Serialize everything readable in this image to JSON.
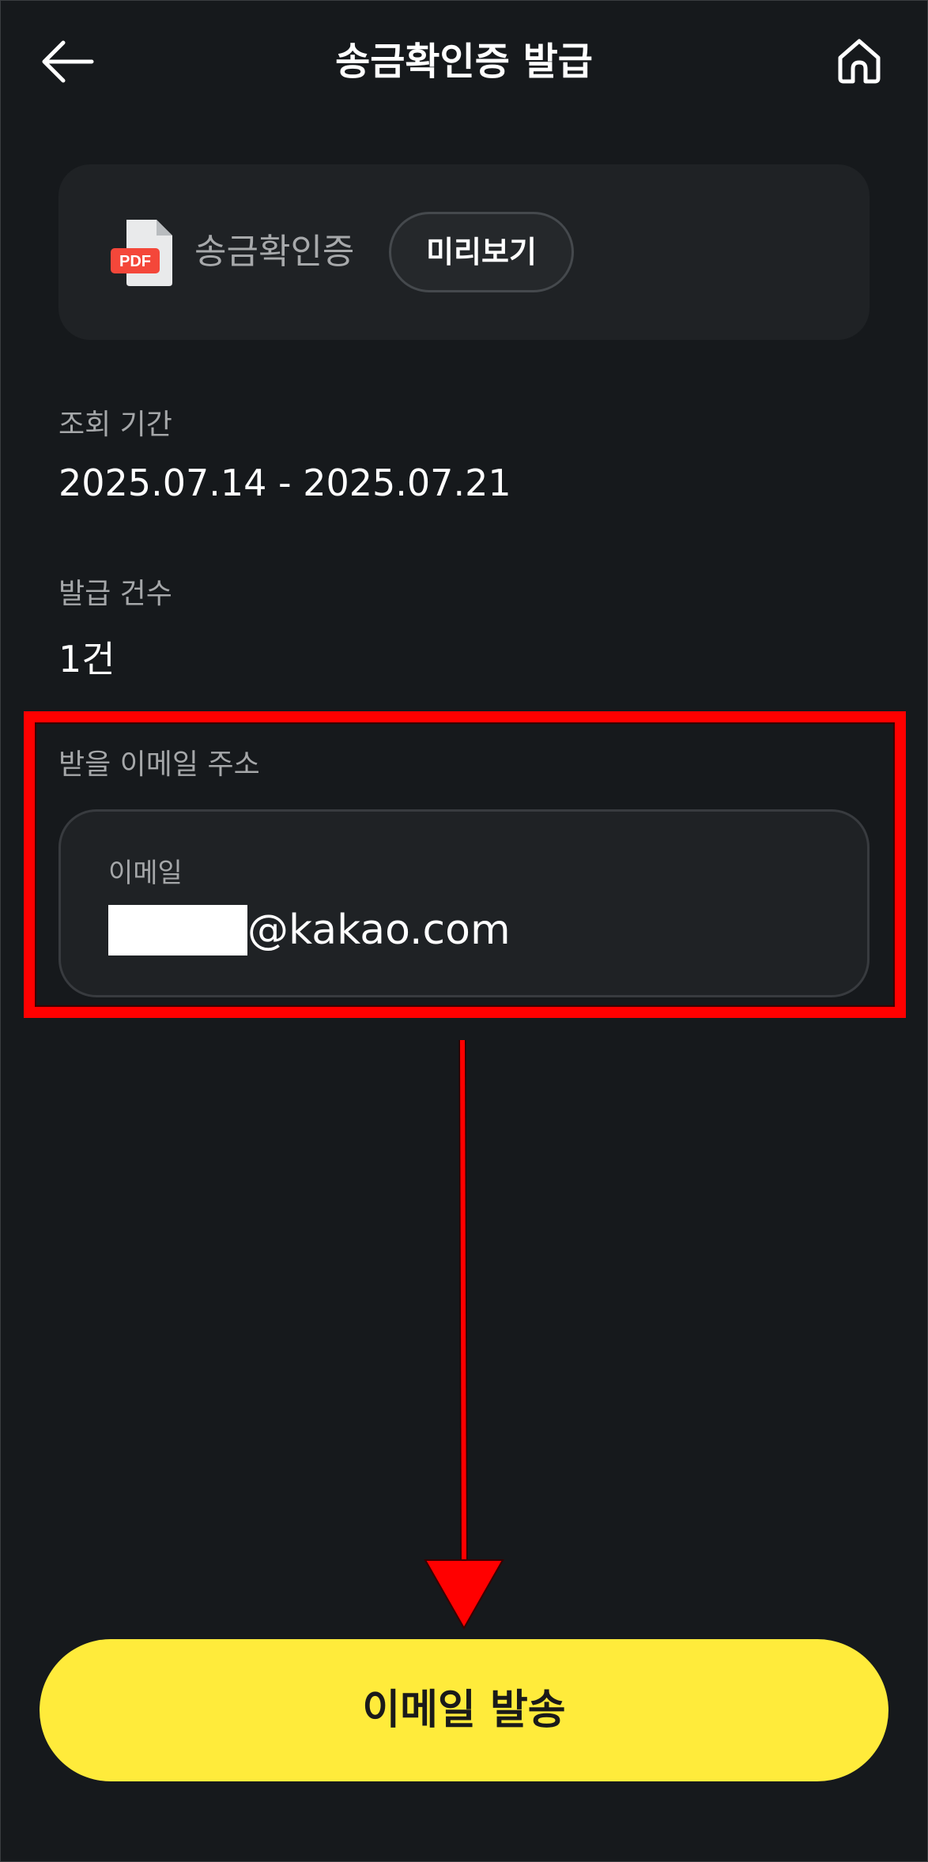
{
  "header": {
    "title": "송금확인증 발급",
    "back_icon": "arrow-left-icon",
    "home_icon": "home-icon"
  },
  "document": {
    "file_type": "PDF",
    "name": "송금확인증",
    "preview_label": "미리보기"
  },
  "period": {
    "label": "조회 기간",
    "value": "2025.07.14 - 2025.07.21"
  },
  "count": {
    "label": "발급 건수",
    "value": "1건"
  },
  "email": {
    "section_label": "받을 이메일 주소",
    "field_label": "이메일",
    "domain": "@kakao.com"
  },
  "submit": {
    "label": "이메일 발송"
  },
  "colors": {
    "background": "#16191c",
    "card": "#1f2225",
    "accent_yellow": "#ffeb3b",
    "annotation_red": "#ff0000",
    "pdf_red": "#f4473a"
  }
}
